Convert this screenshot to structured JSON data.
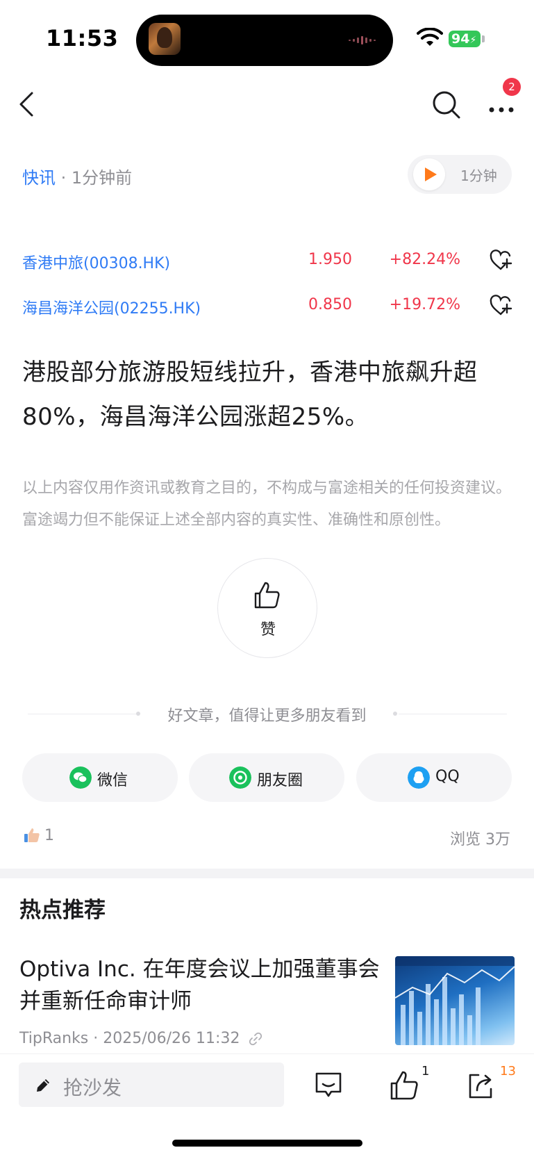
{
  "status_bar": {
    "time": "11:53",
    "battery": "94"
  },
  "nav": {
    "badge": "2",
    "icons": [
      "back-chevron-icon",
      "search-icon",
      "more-icon"
    ]
  },
  "meta": {
    "category": "快讯",
    "separator": " · ",
    "published": "1分钟前",
    "audio_label": "1分钟"
  },
  "stocks": [
    {
      "name": "香港中旅(00308.HK)",
      "price": "1.950",
      "change": "+82.24%"
    },
    {
      "name": "海昌海洋公园(02255.HK)",
      "price": "0.850",
      "change": "+19.72%"
    }
  ],
  "article": {
    "headline": "港股部分旅游股短线拉升，香港中旅飙升超80%，海昌海洋公园涨超25%。",
    "disclaimer": "以上内容仅用作资讯或教育之目的，不构成与富途相关的任何投资建议。富途竭力但不能保证上述全部内容的真实性、准确性和原创性。"
  },
  "like_button": {
    "label": "赞"
  },
  "share": {
    "prompt": "好文章，值得让更多朋友看到",
    "buttons": [
      {
        "label": "微信",
        "color": "#1ac15c"
      },
      {
        "label": "朋友圈",
        "color": "#1ac15c"
      },
      {
        "label": "QQ",
        "color": "#1ea0f2"
      }
    ]
  },
  "stats": {
    "likes": "1",
    "views": "浏览  3万"
  },
  "hot": {
    "title": "热点推荐",
    "items": [
      {
        "title": "Optiva Inc. 在年度会议上加强董事会并重新任命审计师",
        "meta": "TipRanks · 2025/06/26 11:32"
      }
    ]
  },
  "bottom_bar": {
    "comment_placeholder": "抢沙发",
    "like_count": "1",
    "share_count": "13"
  },
  "colors": {
    "accent": "#2f7bf5",
    "up": "#f0364a",
    "orange": "#ff7a1a"
  }
}
